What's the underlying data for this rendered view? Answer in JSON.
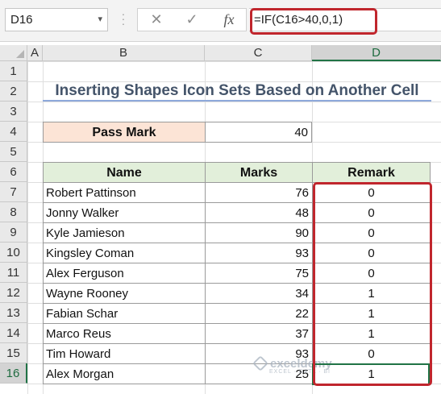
{
  "formula_bar": {
    "name_box": "D16",
    "name_box_dropdown": "▾",
    "cancel_icon": "✕",
    "enter_icon": "✓",
    "fx_label": "fx",
    "formula": "=IF(C16>40,0,1)"
  },
  "columns": [
    "A",
    "B",
    "C",
    "D"
  ],
  "rows": [
    "1",
    "2",
    "3",
    "4",
    "5",
    "6",
    "7",
    "8",
    "9",
    "10",
    "11",
    "12",
    "13",
    "14",
    "15",
    "16"
  ],
  "selected_cell": "D16",
  "title": "Inserting Shapes Icon Sets Based on Another Cell",
  "pass_mark": {
    "label": "Pass Mark",
    "value": "40"
  },
  "table": {
    "headers": [
      "Name",
      "Marks",
      "Remark"
    ],
    "rows": [
      {
        "name": "Robert Pattinson",
        "marks": "76",
        "remark": "0"
      },
      {
        "name": "Jonny Walker",
        "marks": "48",
        "remark": "0"
      },
      {
        "name": "Kyle Jamieson",
        "marks": "90",
        "remark": "0"
      },
      {
        "name": "Kingsley Coman",
        "marks": "93",
        "remark": "0"
      },
      {
        "name": "Alex Ferguson",
        "marks": "75",
        "remark": "0"
      },
      {
        "name": "Wayne Rooney",
        "marks": "34",
        "remark": "1"
      },
      {
        "name": "Fabian Schar",
        "marks": "22",
        "remark": "1"
      },
      {
        "name": "Marco Reus",
        "marks": "37",
        "remark": "1"
      },
      {
        "name": "Tim Howard",
        "marks": "93",
        "remark": "0"
      },
      {
        "name": "Alex Morgan",
        "marks": "25",
        "remark": "1"
      }
    ]
  },
  "watermark": {
    "name": "exceldemy",
    "subtitle": "EXCEL · DATA · BI"
  },
  "colors": {
    "highlight_red": "#c0262d",
    "excel_green": "#217346",
    "header_fill": "#e2efda",
    "pass_fill": "#fce4d6",
    "title_color": "#44546a"
  }
}
